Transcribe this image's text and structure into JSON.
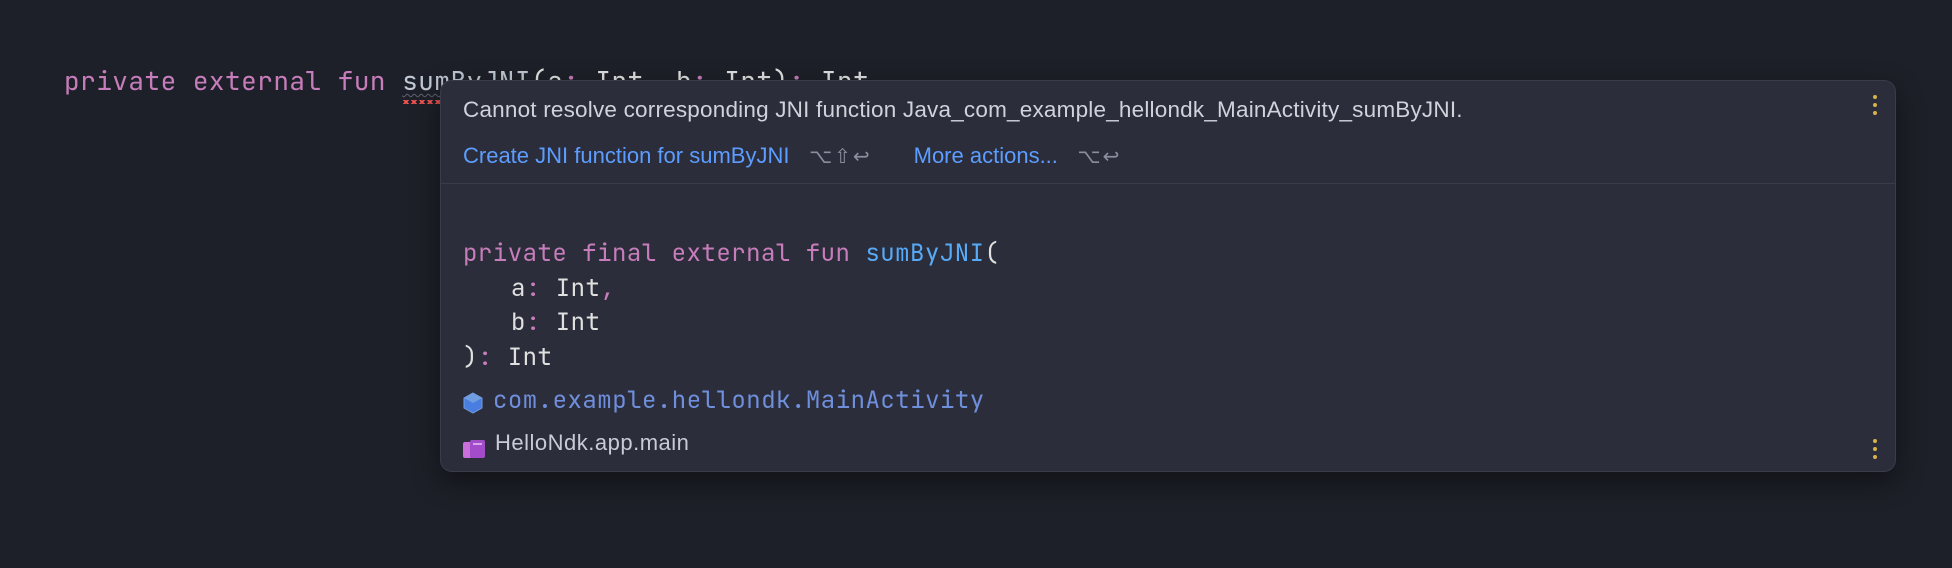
{
  "code": {
    "kw_private": "private",
    "kw_external": "external",
    "kw_fun": "fun",
    "fn_name": "sumByJNI",
    "open": "(",
    "p1": "a",
    "p1t": "Int",
    "p2": "b",
    "p2t": "Int",
    "close": ")",
    "ret": "Int",
    "colon": ":",
    "comma": ","
  },
  "tooltip": {
    "message": "Cannot resolve corresponding JNI function Java_com_example_hellondk_MainActivity_sumByJNI.",
    "action1": "Create JNI function for sumByJNI",
    "shortcut1": "⌥⇧↩",
    "action2": "More actions...",
    "shortcut2": "⌥↩",
    "sig": {
      "kw_private": "private",
      "kw_final": "final",
      "kw_external": "external",
      "kw_fun": "fun",
      "fn_name": "sumByJNI",
      "open": "(",
      "p1": "a",
      "p1t": "Int",
      "p2": "b",
      "p2t": "Int",
      "close": ")",
      "colon": ":",
      "comma": ",",
      "ret": "Int"
    },
    "class_path": "com.example.hellondk.MainActivity",
    "module_path": "HelloNdk.app.main"
  }
}
